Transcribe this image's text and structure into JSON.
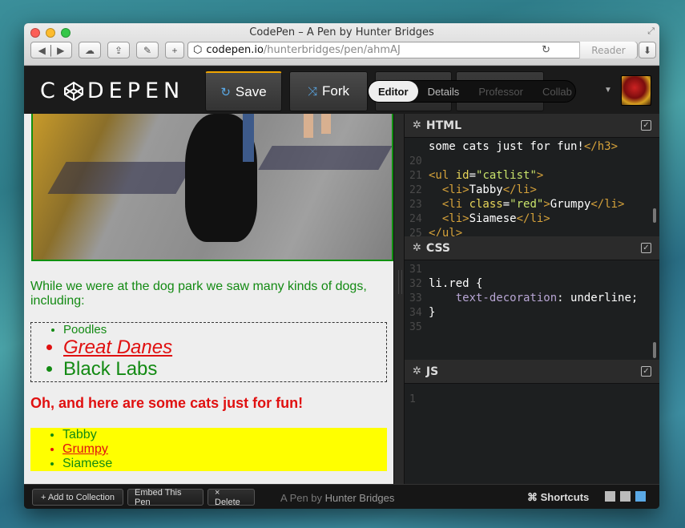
{
  "window": {
    "title": "CodePen – A Pen by Hunter Bridges",
    "url_host": "codepen.io",
    "url_path": "/hunterbridges/pen/ahmAJ",
    "reader_label": "Reader"
  },
  "header": {
    "logo_text_left": "C",
    "logo_text_right": "DEPEN",
    "save_label": "Save",
    "fork_label": "Fork",
    "tabs": [
      {
        "label": "Editor",
        "active": true
      },
      {
        "label": "Details",
        "active": false
      },
      {
        "label": "Professor",
        "active": false
      },
      {
        "label": "Collab",
        "active": false
      }
    ]
  },
  "preview": {
    "intro": "While we were at the dog park we saw many kinds of dogs, including:",
    "dogs": [
      "Poodles",
      "Great Danes",
      "Black Labs"
    ],
    "cats_heading": "Oh, and here are some cats just for fun!",
    "cats": [
      "Tabby",
      "Grumpy",
      "Siamese"
    ]
  },
  "panes": {
    "html": {
      "title": "HTML",
      "lines": [
        {
          "n": "",
          "t": "some cats just for fun!</h3>"
        },
        {
          "n": "20",
          "t": ""
        },
        {
          "n": "21",
          "t": "<ul id=\"catlist\">"
        },
        {
          "n": "22",
          "t": "  <li>Tabby</li>"
        },
        {
          "n": "23",
          "t": "  <li class=\"red\">Grumpy</li>"
        },
        {
          "n": "24",
          "t": "  <li>Siamese</li>"
        },
        {
          "n": "25",
          "t": "</ul>"
        }
      ]
    },
    "css": {
      "title": "CSS",
      "lines": [
        {
          "n": "31",
          "t": ""
        },
        {
          "n": "32",
          "t": "li.red {"
        },
        {
          "n": "33",
          "t": "    text-decoration: underline;"
        },
        {
          "n": "34",
          "t": "}"
        },
        {
          "n": "35",
          "t": ""
        }
      ]
    },
    "js": {
      "title": "JS",
      "lines": [
        {
          "n": "1",
          "t": ""
        }
      ]
    }
  },
  "footer": {
    "add_collection": "+ Add to Collection",
    "embed": "Embed This Pen",
    "delete": "× Delete",
    "byline_prefix": "A Pen by",
    "byline_name": "Hunter Bridges",
    "shortcuts": "⌘ Shortcuts"
  }
}
